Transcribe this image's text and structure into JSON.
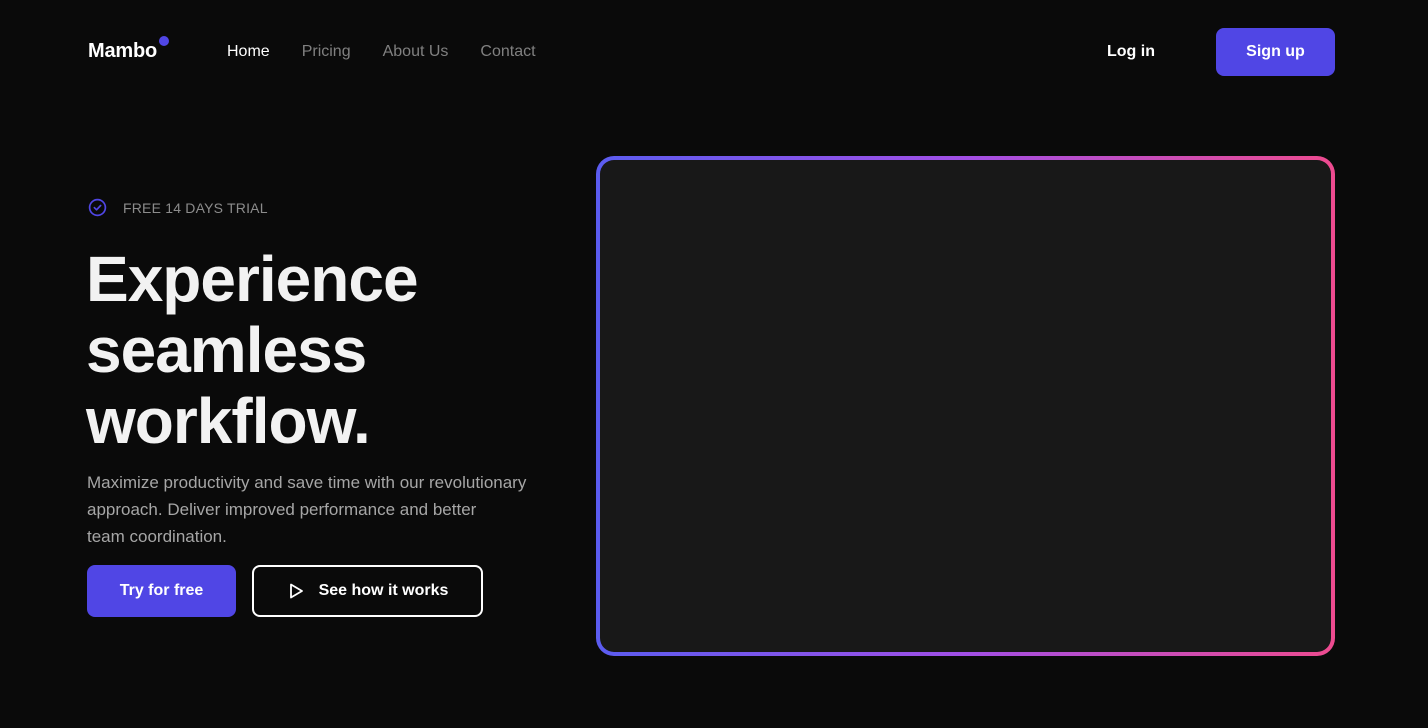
{
  "brand": {
    "name": "Mambo",
    "accent_color": "#5046e5"
  },
  "nav": {
    "items": [
      {
        "label": "Home",
        "active": true
      },
      {
        "label": "Pricing",
        "active": false
      },
      {
        "label": "About Us",
        "active": false
      },
      {
        "label": "Contact",
        "active": false
      }
    ],
    "login_label": "Log in",
    "signup_label": "Sign up"
  },
  "hero": {
    "badge_icon": "check-circle-icon",
    "badge_text": "FREE 14 DAYS TRIAL",
    "headline_lines": [
      "Experience",
      "seamless",
      "workflow."
    ],
    "description_lines": [
      "Maximize productivity and save time with our revolutionary",
      "approach. Deliver improved performance and better",
      "team coordination."
    ],
    "primary_cta": "Try for free",
    "secondary_cta": "See how it works",
    "secondary_cta_icon": "play-icon"
  },
  "media": {
    "gradient_colors": [
      "#5b5cf0",
      "#a24fe6",
      "#ee4b8f"
    ],
    "background_color": "#181818"
  }
}
